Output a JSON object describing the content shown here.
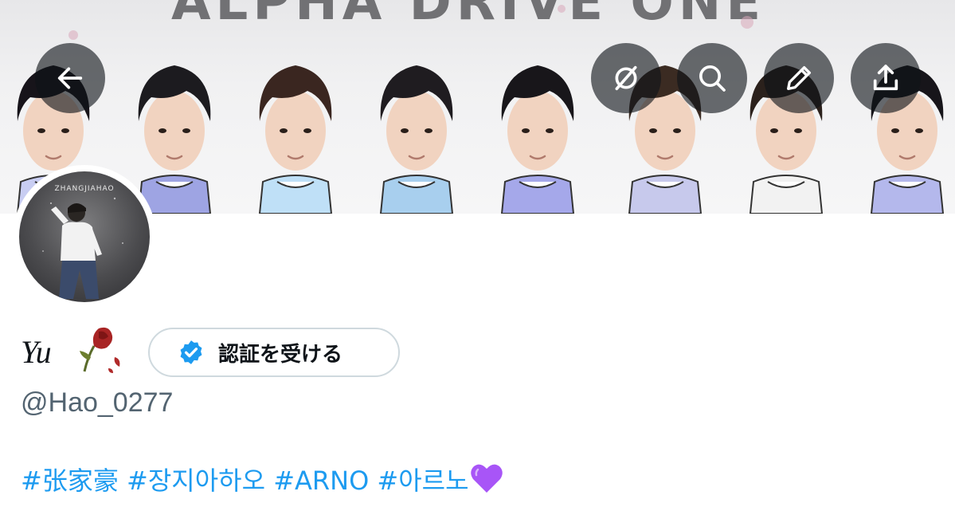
{
  "banner": {
    "title_text": "ALPHA DRIVE ONE",
    "shirt_colors": [
      "#c8cdf2",
      "#9ea4e3",
      "#bfe0f7",
      "#a8cfee",
      "#a5a8ea",
      "#c7c9ec",
      "#f2f2f2",
      "#b4b8ec"
    ]
  },
  "nav": {
    "back_icon": "arrow-left-icon",
    "translate_icon": "translate-off-icon",
    "search_icon": "search-icon",
    "edit_icon": "pencil-icon",
    "share_icon": "share-upload-icon"
  },
  "avatar": {
    "caption": "ZHANGJIAHAO"
  },
  "profile": {
    "display_name": "Yu",
    "name_emoji": "wilted-rose-icon",
    "verify_button_label": "認証を受ける",
    "handle": "@Hao_0277"
  },
  "bio": {
    "tags": [
      "#张家豪",
      "#장지아하오",
      "#ARNO",
      "#아르노"
    ],
    "emoji": "purple-heart-icon"
  },
  "colors": {
    "link": "#1d9bf0",
    "verified_badge": "#1d9bf0",
    "heart": "#a855f7",
    "rose": "#b02a2a"
  }
}
